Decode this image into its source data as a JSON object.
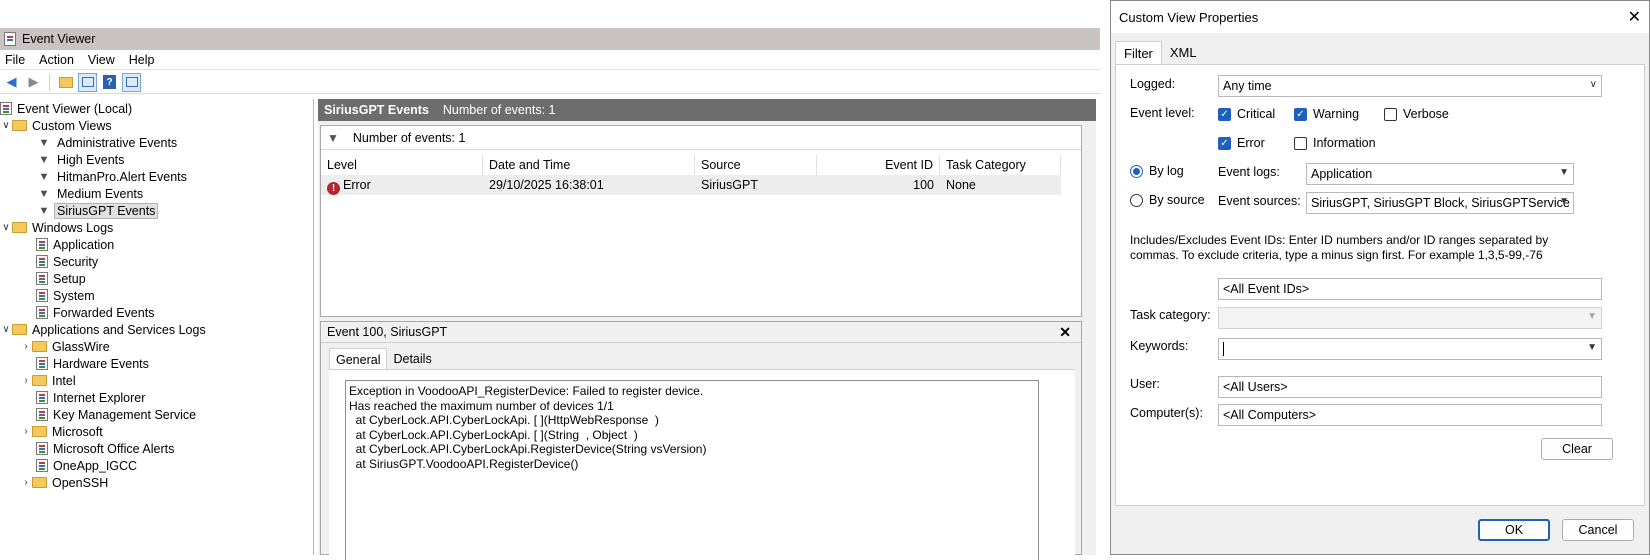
{
  "event_viewer": {
    "title": "Event Viewer",
    "menu": [
      "File",
      "Action",
      "View",
      "Help"
    ],
    "toolbar_icons": [
      "back-icon",
      "forward-icon",
      "up-folder-icon",
      "show-hide-tree-icon",
      "help-icon",
      "show-hide-action-icon"
    ],
    "tree": {
      "root": "Event Viewer (Local)",
      "custom_views": "Custom Views",
      "custom_items": [
        "Administrative Events",
        "High Events",
        "HitmanPro.Alert Events",
        "Medium Events",
        "SiriusGPT Events"
      ],
      "windows_logs": "Windows Logs",
      "windows_items": [
        "Application",
        "Security",
        "Setup",
        "System",
        "Forwarded Events"
      ],
      "apps_services": "Applications and Services Logs",
      "apps_items": [
        "GlassWire",
        "Hardware Events",
        "Intel",
        "Internet Explorer",
        "Key Management Service",
        "Microsoft",
        "Microsoft Office Alerts",
        "OneApp_IGCC",
        "OpenSSH"
      ]
    },
    "center": {
      "view_title": "SiriusGPT Events",
      "view_count": "Number of events: 1",
      "filter_count": "Number of events: 1",
      "columns": [
        "Level",
        "Date and Time",
        "Source",
        "Event ID",
        "Task Category"
      ],
      "row": {
        "level": "Error",
        "datetime": "29/10/2025 16:38:01",
        "source": "SiriusGPT",
        "event_id": "100",
        "task_category": "None"
      },
      "detail_title": "Event 100, SiriusGPT",
      "detail_tabs": [
        "General",
        "Details"
      ],
      "detail_text": "Exception in VoodooAPI_RegisterDevice: Failed to register device.\nHas reached the maximum number of devices 1/1\n  at CyberLock.API.CyberLockApi. [ ](HttpWebResponse  )\n  at CyberLock.API.CyberLockApi. [ ](String  , Object  )\n  at CyberLock.API.CyberLockApi.RegisterDevice(String vsVersion)\n  at SiriusGPT.VoodooAPI.RegisterDevice()"
    }
  },
  "dialog": {
    "title": "Custom View Properties",
    "tabs": [
      "Filter",
      "XML"
    ],
    "logged_label": "Logged:",
    "logged_value": "Any time",
    "event_level_label": "Event level:",
    "levels": {
      "critical": "Critical",
      "warning": "Warning",
      "verbose": "Verbose",
      "error": "Error",
      "information": "Information"
    },
    "by_log": "By log",
    "by_source": "By source",
    "event_logs_label": "Event logs:",
    "event_logs_value": "Application",
    "event_sources_label": "Event sources:",
    "event_sources_value": "SiriusGPT, SiriusGPT Block, SiriusGPTService",
    "ids_note": "Includes/Excludes Event IDs: Enter ID numbers and/or ID ranges separated by commas. To exclude criteria, type a minus sign first. For example 1,3,5-99,-76",
    "ids_value": "<All Event IDs>",
    "task_category_label": "Task category:",
    "keywords_label": "Keywords:",
    "user_label": "User:",
    "user_value": "<All Users>",
    "computers_label": "Computer(s):",
    "computers_value": "<All Computers>",
    "clear": "Clear",
    "ok": "OK",
    "cancel": "Cancel"
  }
}
